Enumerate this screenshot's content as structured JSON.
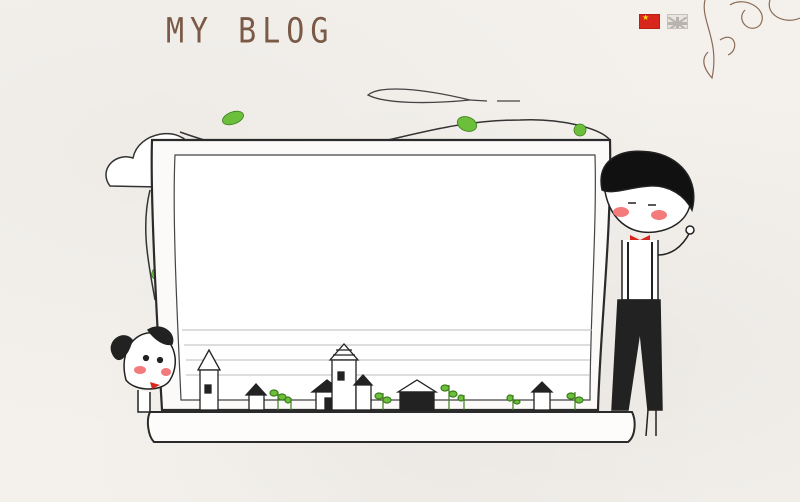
{
  "header": {
    "site_title": "MY BLOG"
  },
  "language_switch": {
    "items": [
      {
        "name": "china-flag-icon"
      },
      {
        "name": "uk-flag-icon"
      }
    ]
  },
  "colors": {
    "title": "#7a5a47",
    "leaf": "#6cbf3b",
    "cheek": "#f37b7b",
    "ink": "#2b2b2b"
  }
}
